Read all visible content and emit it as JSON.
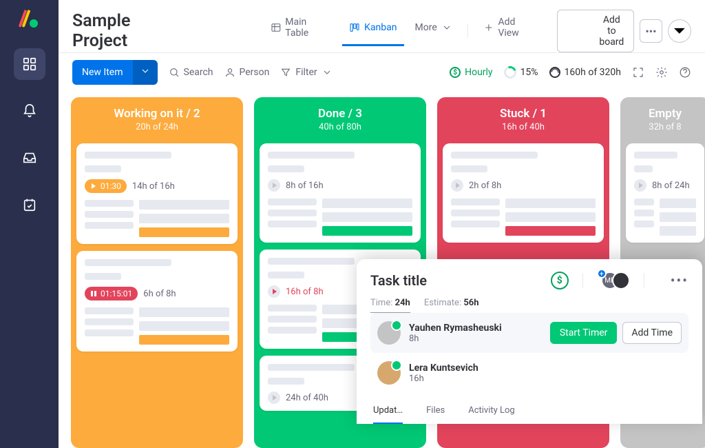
{
  "project": {
    "title": "Sample Project"
  },
  "views": {
    "main_table": "Main Table",
    "kanban": "Kanban",
    "more": "More",
    "add_view": "Add View"
  },
  "top_actions": {
    "add_to_board": "Add to board"
  },
  "toolbar": {
    "new_item": "New Item",
    "search": "Search",
    "person": "Person",
    "filter": "Filter"
  },
  "stats": {
    "hourly": "Hourly",
    "percent": "15%",
    "hours": "160h of 320h"
  },
  "columns": [
    {
      "title": "Working on it / 2",
      "sub": "20h of 24h",
      "color": "orange"
    },
    {
      "title": "Done / 3",
      "sub": "40h of 80h",
      "color": "green"
    },
    {
      "title": "Stuck / 1",
      "sub": "16h of 40h",
      "color": "red"
    },
    {
      "title": "Empty",
      "sub": "32h of 8",
      "color": "grey"
    }
  ],
  "cards": {
    "c0_0": {
      "chip": "01:30",
      "hours": "14h of 16h"
    },
    "c0_1": {
      "chip": "01:15:01",
      "hours": "6h of 8h"
    },
    "c1_0": {
      "hours": "8h of 16h"
    },
    "c1_1": {
      "hours": "16h of 8h"
    },
    "c1_2": {
      "hours": "24h of 40h"
    },
    "c2_0": {
      "hours": "2h of 8h"
    },
    "c3_0": {
      "hours": "8h of 24h"
    }
  },
  "task": {
    "title": "Task title",
    "time_label": "Time:",
    "time_value": "24h",
    "estimate_label": "Estimate:",
    "estimate_value": "56h",
    "start_timer": "Start Timer",
    "add_time": "Add Time",
    "avatar_initials": "МR",
    "assignees": [
      {
        "name": "Yauhen Rymasheuski",
        "hours": "8h"
      },
      {
        "name": "Lera Kuntsevich",
        "hours": "16h"
      }
    ],
    "subtabs": {
      "updates": "Updat…",
      "files": "Files",
      "activity": "Activity Log"
    }
  }
}
